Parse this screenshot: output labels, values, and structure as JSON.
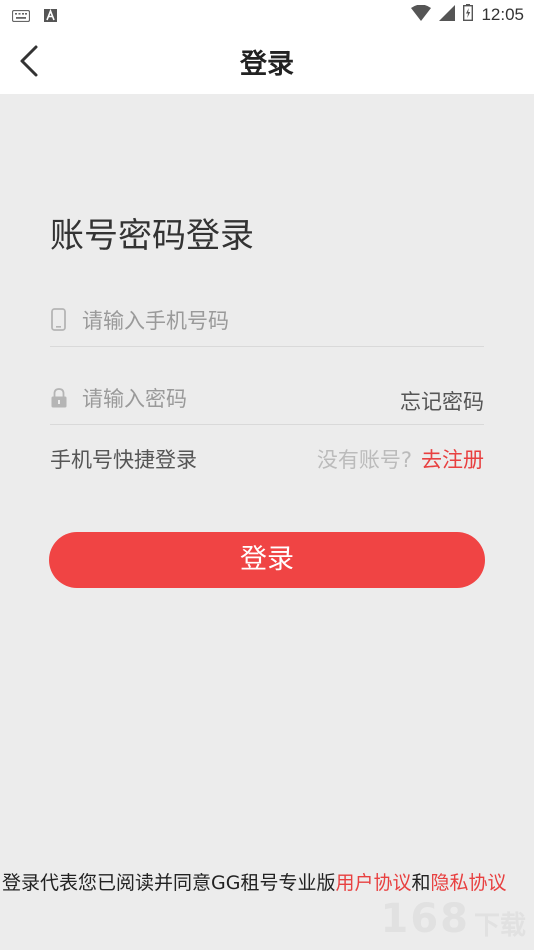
{
  "status_bar": {
    "time": "12:05",
    "left_icons": [
      "keyboard-icon",
      "a-notification-icon"
    ],
    "right_icons": [
      "wifi-icon",
      "signal-icon",
      "battery-icon"
    ]
  },
  "header": {
    "title": "登录",
    "back_icon": "chevron-left-icon"
  },
  "form": {
    "heading": "账号密码登录",
    "phone": {
      "placeholder": "请输入手机号码",
      "value": "",
      "icon": "phone-icon"
    },
    "password": {
      "placeholder": "请输入密码",
      "value": "",
      "icon": "lock-icon"
    },
    "forgot_label": "忘记密码",
    "quick_login_label": "手机号快捷登录",
    "no_account_label": "没有账号?",
    "register_label": "去注册",
    "submit_label": "登录"
  },
  "agreement": {
    "prefix": "登录代表您已阅读并同意GG租号专业版",
    "user_agreement": "用户协议",
    "and": "和",
    "privacy_policy": "隐私协议"
  },
  "watermark": {
    "number": "168",
    "text": "下载"
  },
  "colors": {
    "accent": "#f04444",
    "link": "#e84040",
    "background": "#ececec"
  }
}
